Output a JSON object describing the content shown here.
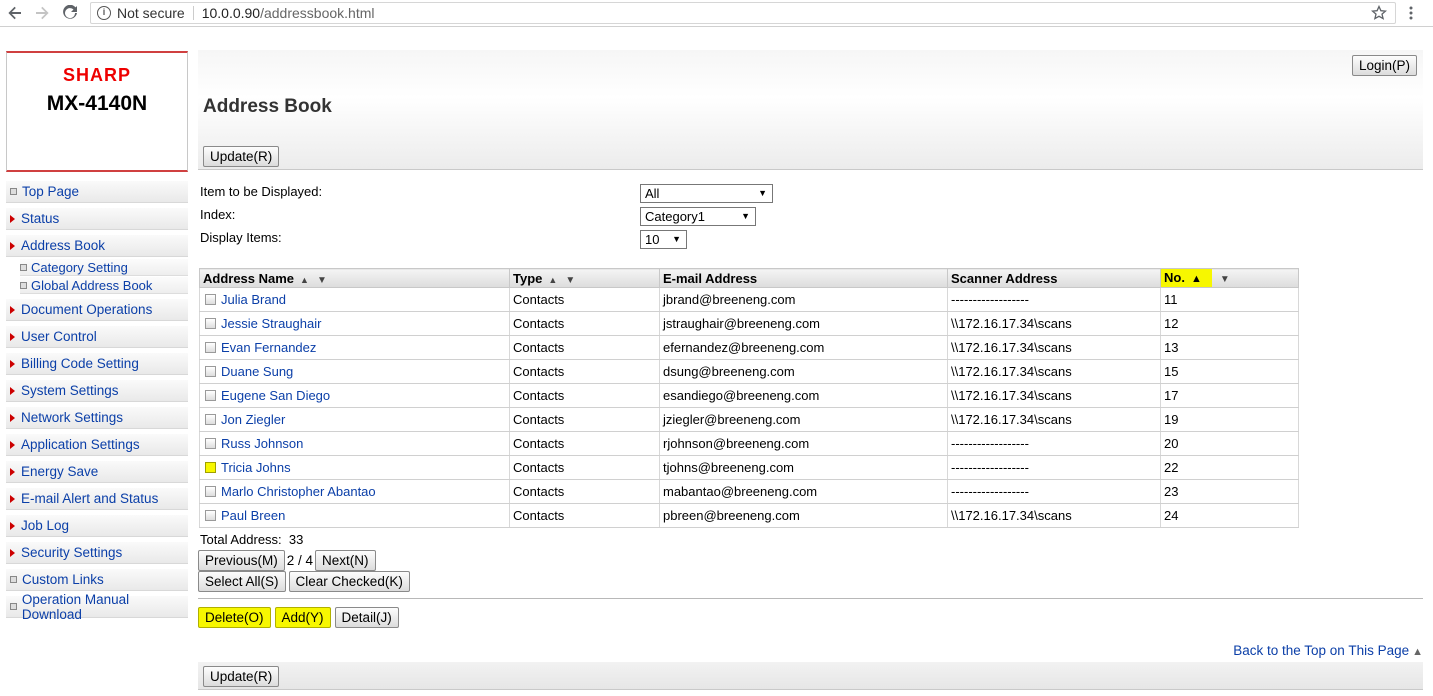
{
  "browser": {
    "security": "Not secure",
    "url_host": "10.0.0.90",
    "url_path": "/addressbook.html"
  },
  "device": {
    "brand": "SHARP",
    "model": "MX-4140N"
  },
  "nav": {
    "items": [
      {
        "label": "Top Page",
        "marker": "square"
      },
      {
        "label": "Status",
        "marker": "triangle"
      },
      {
        "label": "Address Book",
        "marker": "triangle"
      },
      {
        "label": "Document Operations",
        "marker": "triangle"
      },
      {
        "label": "User Control",
        "marker": "triangle"
      },
      {
        "label": "Billing Code Setting",
        "marker": "triangle"
      },
      {
        "label": "System Settings",
        "marker": "triangle"
      },
      {
        "label": "Network Settings",
        "marker": "triangle"
      },
      {
        "label": "Application Settings",
        "marker": "triangle"
      },
      {
        "label": "Energy Save",
        "marker": "triangle"
      },
      {
        "label": "E-mail Alert and Status",
        "marker": "triangle"
      },
      {
        "label": "Job Log",
        "marker": "triangle"
      },
      {
        "label": "Security Settings",
        "marker": "triangle"
      },
      {
        "label": "Custom Links",
        "marker": "square"
      },
      {
        "label": "Operation Manual Download",
        "marker": "square"
      }
    ],
    "sub_items": [
      "Category Setting",
      "Global Address Book"
    ]
  },
  "header": {
    "title": "Address Book",
    "login_label": "Login(P)",
    "update_label": "Update(R)"
  },
  "filters": {
    "display_label": "Item to be Displayed:",
    "display_value": "All",
    "index_label": "Index:",
    "index_value": "Category1",
    "items_label": "Display Items:",
    "items_value": "10"
  },
  "table": {
    "headers": [
      "Address Name",
      "Type",
      "E-mail Address",
      "Scanner Address",
      "No."
    ],
    "rows": [
      {
        "name": "Julia Brand",
        "type": "Contacts",
        "email": "jbrand@breeneng.com",
        "scanner": "------------------",
        "no": "11"
      },
      {
        "name": "Jessie Straughair",
        "type": "Contacts",
        "email": "jstraughair@breeneng.com",
        "scanner": "\\\\172.16.17.34\\scans",
        "no": "12"
      },
      {
        "name": "Evan Fernandez",
        "type": "Contacts",
        "email": "efernandez@breeneng.com",
        "scanner": "\\\\172.16.17.34\\scans",
        "no": "13"
      },
      {
        "name": "Duane Sung",
        "type": "Contacts",
        "email": "dsung@breeneng.com",
        "scanner": "\\\\172.16.17.34\\scans",
        "no": "15"
      },
      {
        "name": "Eugene San Diego",
        "type": "Contacts",
        "email": "esandiego@breeneng.com",
        "scanner": "\\\\172.16.17.34\\scans",
        "no": "17"
      },
      {
        "name": "Jon Ziegler",
        "type": "Contacts",
        "email": "jziegler@breeneng.com",
        "scanner": "\\\\172.16.17.34\\scans",
        "no": "19"
      },
      {
        "name": "Russ Johnson",
        "type": "Contacts",
        "email": "rjohnson@breeneng.com",
        "scanner": "------------------",
        "no": "20"
      },
      {
        "name": "Tricia Johns",
        "type": "Contacts",
        "email": "tjohns@breeneng.com",
        "scanner": "------------------",
        "no": "22"
      },
      {
        "name": "Marlo Christopher Abantao",
        "type": "Contacts",
        "email": "mabantao@breeneng.com",
        "scanner": "------------------",
        "no": "23"
      },
      {
        "name": "Paul Breen",
        "type": "Contacts",
        "email": "pbreen@breeneng.com",
        "scanner": "\\\\172.16.17.34\\scans",
        "no": "24"
      }
    ],
    "highlighted_row_index": 7
  },
  "summary": {
    "total_label": "Total Address:",
    "total_value": "33"
  },
  "pager": {
    "prev_label": "Previous(M)",
    "page_text": "2 / 4",
    "next_label": "Next(N)"
  },
  "selection": {
    "select_all_label": "Select All(S)",
    "clear_label": "Clear Checked(K)"
  },
  "actions": {
    "delete_label": "Delete(O)",
    "add_label": "Add(Y)",
    "detail_label": "Detail(J)"
  },
  "footer": {
    "back_top_label": "Back to the Top on This Page",
    "update_label": "Update(R)"
  },
  "colors": {
    "highlight": "#f7f700",
    "link": "#0b3fa8",
    "brand_red": "#e00000"
  }
}
